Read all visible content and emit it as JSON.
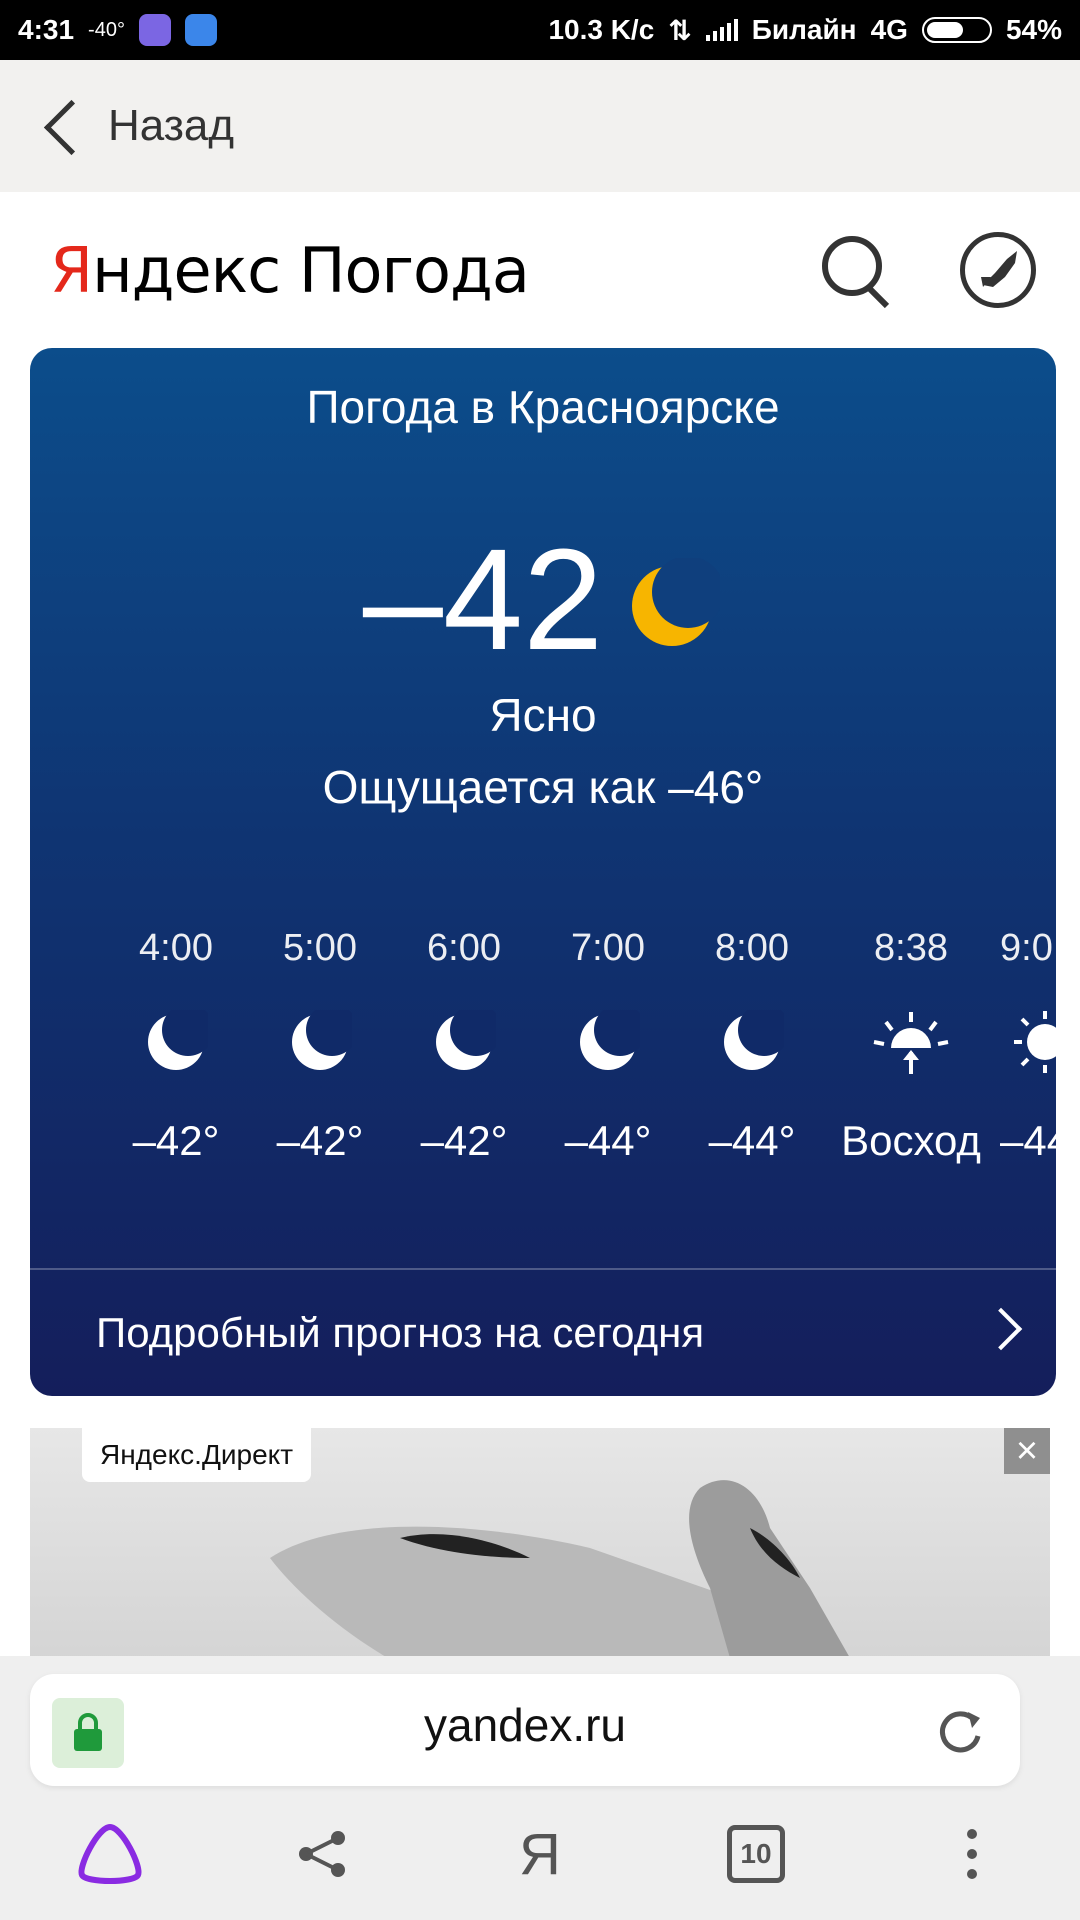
{
  "status_bar": {
    "time": "4:31",
    "temp": "-40°",
    "speed": "10.3 K/c",
    "carrier": "Билайн",
    "network": "4G",
    "battery": "54%"
  },
  "topbar": {
    "back_label": "Назад"
  },
  "header": {
    "logo_yandex": "Яндекс",
    "logo_pogoda": "Погода",
    "icons": {
      "search": "search-icon",
      "rocket": "rocket-icon"
    }
  },
  "weather": {
    "title": "Погода в Красноярске",
    "temperature": "–42",
    "condition": "Ясно",
    "feels_like": "Ощущается как –46°",
    "hourly": [
      {
        "time": "4:00",
        "icon": "moon-icon",
        "value": "–42°"
      },
      {
        "time": "5:00",
        "icon": "moon-icon",
        "value": "–42°"
      },
      {
        "time": "6:00",
        "icon": "moon-icon",
        "value": "–42°"
      },
      {
        "time": "7:00",
        "icon": "moon-icon",
        "value": "–44°"
      },
      {
        "time": "8:00",
        "icon": "moon-icon",
        "value": "–44°"
      },
      {
        "time": "8:38",
        "icon": "sunrise-icon",
        "value": "Восход"
      },
      {
        "time": "9:0",
        "icon": "sun-icon",
        "value": "–44"
      }
    ],
    "detail_link": "Подробный прогноз на сегодня",
    "colors": {
      "moon": "#f7b500",
      "card_top": "#0c4d8b",
      "card_bottom": "#141e5b"
    }
  },
  "ad": {
    "label": "Яндекс.Директ",
    "close": "×"
  },
  "urlbar": {
    "url": "yandex.ru"
  },
  "bottom_nav": {
    "ya": "Я",
    "tabs_count": "10"
  }
}
